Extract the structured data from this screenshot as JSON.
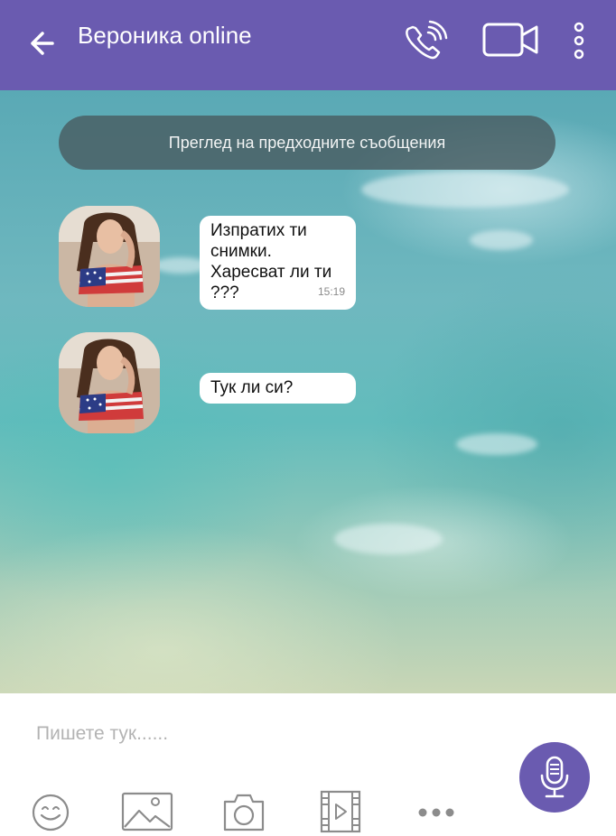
{
  "header": {
    "title": "Вероника online",
    "back_icon": "arrow-left-icon",
    "call_icon": "phone-call-icon",
    "video_icon": "video-camera-icon",
    "more_icon": "vertical-dots-icon",
    "background_color": "#6a5bb0"
  },
  "chat": {
    "history_label": "Преглед на предходните съобщения",
    "messages": [
      {
        "text": "Изпратих ти\nснимки.\nХаресват ли ти\n???",
        "time": "15:19"
      },
      {
        "text": "Тук ли си?"
      }
    ]
  },
  "composer": {
    "placeholder": "Пишете тук......",
    "tools": [
      "smiley-icon",
      "image-icon",
      "camera-icon",
      "video-file-icon",
      "more-dots-icon"
    ],
    "mic_icon": "microphone-icon",
    "mic_color": "#6a5bb0"
  }
}
